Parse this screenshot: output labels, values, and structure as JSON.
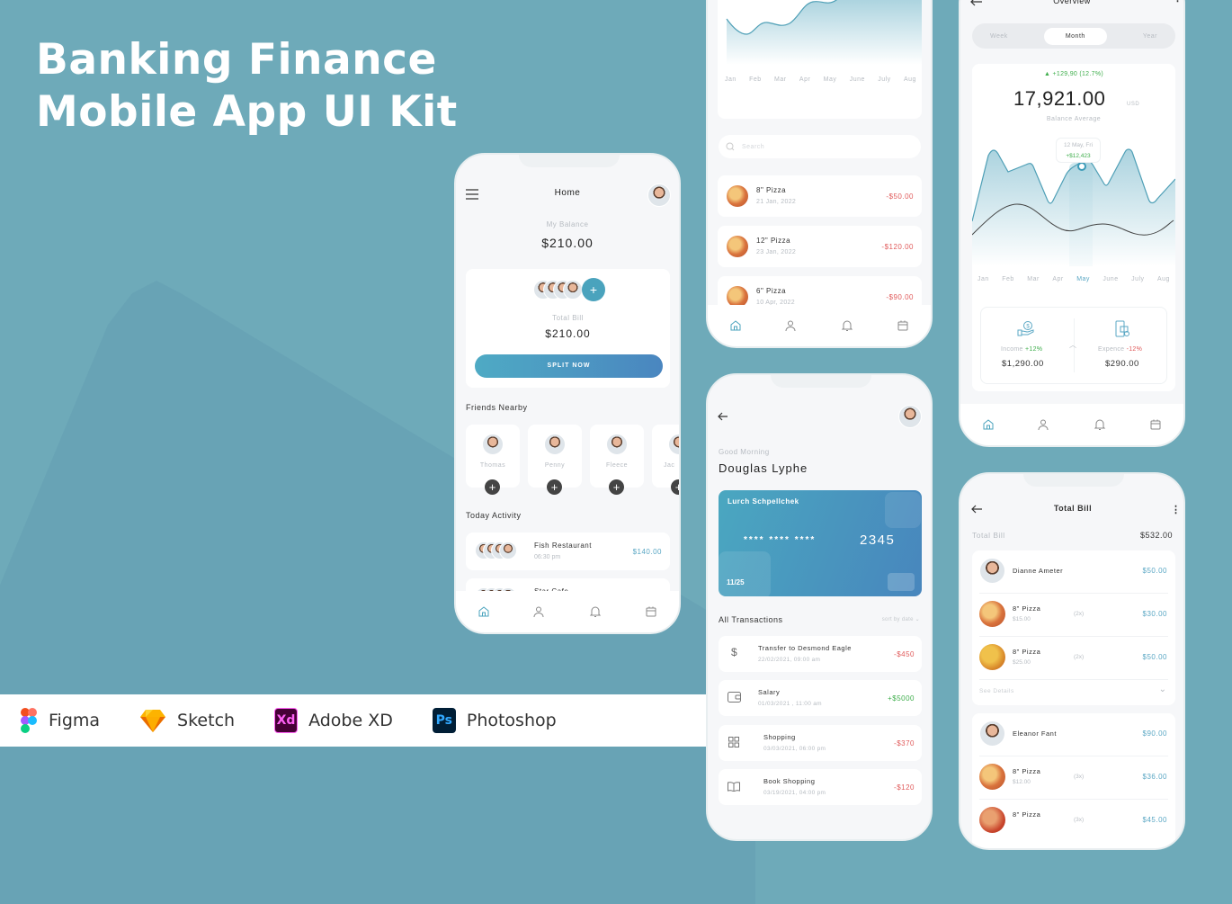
{
  "hero": {
    "line1": "Banking Finance",
    "line2": "Mobile App UI Kit"
  },
  "tools": [
    {
      "icon": "figma-icon",
      "label": "Figma"
    },
    {
      "icon": "sketch-icon",
      "label": "Sketch"
    },
    {
      "icon": "adobe-xd-icon",
      "label": "Adobe XD",
      "glyph": "Xd"
    },
    {
      "icon": "photoshop-icon",
      "label": "Photoshop",
      "glyph": "Ps"
    }
  ],
  "colors": {
    "background": "#6eaab9",
    "accent": "#4fa3c0",
    "negative": "#e05a5a",
    "positive": "#3fae4c"
  },
  "home": {
    "title": "Home",
    "balance_label": "My Balance",
    "balance": "$210.00",
    "add_glyph": "+",
    "total_bill_label": "Total Bill",
    "total_bill": "$210.00",
    "split_button": "SPLIT NOW",
    "friends_title": "Friends Nearby",
    "friends": [
      {
        "name": "Thomas"
      },
      {
        "name": "Penny"
      },
      {
        "name": "Fleece"
      },
      {
        "name": "Jac"
      }
    ],
    "activity_title": "Today Activity",
    "activities": [
      {
        "name": "Fish Restaurant",
        "time": "06:30 pm",
        "amount": "$140.00"
      },
      {
        "name": "Star Cafe",
        "time": "",
        "amount": ""
      }
    ]
  },
  "history": {
    "months": [
      "Jan",
      "Feb",
      "Mar",
      "Apr",
      "May",
      "June",
      "July",
      "Aug"
    ],
    "search_placeholder": "Search",
    "items": [
      {
        "name": "8\" Pizza",
        "date": "21 Jan, 2022",
        "amount": "-$50.00"
      },
      {
        "name": "12\" Pizza",
        "date": "23 Jan, 2022",
        "amount": "-$120.00"
      },
      {
        "name": "6\" Pizza",
        "date": "10 Apr, 2022",
        "amount": "-$90.00"
      }
    ]
  },
  "overview": {
    "title": "Overview",
    "tabs": [
      "Week",
      "Month",
      "Year"
    ],
    "active_tab": "Month",
    "change": "+129,90 (12.7%)",
    "balance": "17,921.00",
    "currency": "USD",
    "balance_label": "Balance Average",
    "tooltip_date": "12 May, Fri",
    "tooltip_value": "+$12,423",
    "months": [
      "Jan",
      "Feb",
      "Mar",
      "Apr",
      "May",
      "June",
      "July",
      "Aug"
    ],
    "selected_month": "May",
    "income_label": "Income",
    "income_change": "+12%",
    "income": "$1,290.00",
    "expense_label": "Expence",
    "expense_change": "-12%",
    "expense": "$290.00"
  },
  "card_screen": {
    "greeting": "Good Morning",
    "user": "Douglas Lyphe",
    "card_holder": "Lurch Schpellchek",
    "card_masked": "****  ****  ****",
    "card_last4": "2345",
    "card_expiry": "11/25",
    "transactions_title": "All Transactions",
    "sort_label": "sort by date",
    "transactions": [
      {
        "icon": "dollar-icon",
        "name": "Transfer to Desmond Eagle",
        "date": "22/02/2021, 09:00 am",
        "amount": "-$450"
      },
      {
        "icon": "wallet-icon",
        "name": "Salary",
        "date": "01/03/2021 , 11:00 am",
        "amount": "+$5000"
      },
      {
        "icon": "grid-icon",
        "name": "Shopping",
        "date": "03/03/2021, 06:00 pm",
        "amount": "-$370"
      },
      {
        "icon": "book-icon",
        "name": "Book Shopping",
        "date": "03/19/2021, 04:00 pm",
        "amount": "-$120"
      }
    ]
  },
  "bill": {
    "title": "Total Bill",
    "total_label": "Total Bill",
    "total": "$532.00",
    "see_details": "See Details",
    "groups": [
      {
        "person": "Dianne Ameter",
        "amount": "$50.00",
        "items": [
          {
            "name": "8\" Pizza",
            "price": "$15.00",
            "qty": "(2x)",
            "total": "$30.00"
          },
          {
            "name": "8\" Pizza",
            "price": "$25.00",
            "qty": "(2x)",
            "total": "$50.00"
          }
        ]
      },
      {
        "person": "Eleanor Fant",
        "amount": "$90.00",
        "items": [
          {
            "name": "8\" Pizza",
            "price": "$12.00",
            "qty": "(3x)",
            "total": "$36.00"
          },
          {
            "name": "8\" Pizza",
            "price": "",
            "qty": "(3x)",
            "total": "$45.00"
          }
        ]
      }
    ]
  }
}
